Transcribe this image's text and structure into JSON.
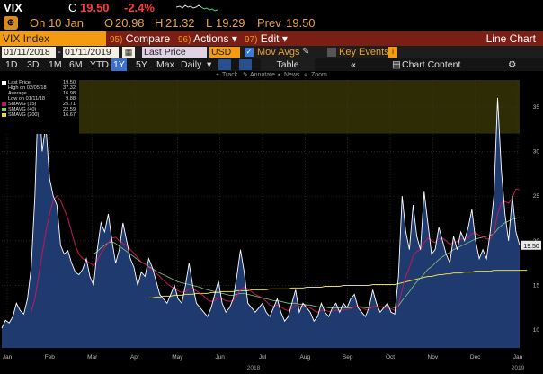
{
  "quote": {
    "ticker": "VIX",
    "c_label": "C",
    "last": "19.50",
    "change": "-2.4%",
    "date": "On 10 Jan",
    "open_label": "O",
    "open": "20.98",
    "high_label": "H",
    "high": "21.32",
    "low_label": "L",
    "low": "19.29",
    "prev_label": "Prev",
    "prev": "19.50"
  },
  "function_bar": {
    "index_label": "VIX Index",
    "compare_num": "95)",
    "compare": "Compare",
    "actions_num": "96)",
    "actions": "Actions",
    "edit_num": "97)",
    "edit": "Edit",
    "chart_type": "Line Chart"
  },
  "options": {
    "start_date": "01/11/2018",
    "end_date": "01/11/2019",
    "field": "Last Price",
    "currency": "USD",
    "mov_avgs": "Mov Avgs",
    "key_events": "Key Events"
  },
  "range": {
    "items": [
      "1D",
      "3D",
      "1M",
      "6M",
      "YTD",
      "1Y",
      "5Y",
      "Max"
    ],
    "selected": "1Y",
    "period": "Daily",
    "table": "Table",
    "chart_content": "Chart Content"
  },
  "subtools": {
    "track": "Track",
    "annotate": "Annotate",
    "news": "News",
    "zoom": "Zoom"
  },
  "legend": [
    {
      "name": "Last Price",
      "value": "19.50",
      "color": "#ffffff"
    },
    {
      "name": "High on 02/05/18",
      "value": "37.32",
      "color": "#000000"
    },
    {
      "name": "Average",
      "value": "16.98",
      "color": "#000000"
    },
    {
      "name": "Low on 01/11/18",
      "value": "9.88",
      "color": "#000000"
    },
    {
      "name": "SMAVG (15)",
      "value": "25.71",
      "color": "#c2185b"
    },
    {
      "name": "SMAVG (40)",
      "value": "22.59",
      "color": "#7fc97f"
    },
    {
      "name": "SMAVG (200)",
      "value": "16.67",
      "color": "#e6d84a"
    }
  ],
  "chart_data": {
    "type": "area",
    "ylim": [
      8,
      38
    ],
    "yticks": [
      10,
      15,
      20,
      25,
      30,
      35
    ],
    "x_labels": [
      "Jan",
      "Feb",
      "Mar",
      "Apr",
      "May",
      "Jun",
      "Jul",
      "Aug",
      "Sep",
      "Oct",
      "Nov",
      "Dec",
      "Jan"
    ],
    "year_labels": [
      "2018",
      "2019"
    ],
    "band": [
      32,
      38
    ],
    "series": [
      {
        "name": "Last Price",
        "values": [
          10.2,
          11.1,
          10.8,
          11.5,
          13.0,
          12.2,
          11.8,
          13.5,
          17.0,
          25.0,
          37.3,
          30.0,
          33.0,
          27.0,
          25.0,
          24.0,
          19.5,
          18.5,
          18.9,
          17.5,
          16.5,
          16.2,
          16.8,
          18.0,
          16.0,
          15.0,
          19.0,
          22.0,
          21.0,
          23.0,
          20.0,
          17.5,
          19.0,
          22.0,
          20.0,
          18.0,
          17.0,
          15.0,
          16.5,
          16.0,
          18.0,
          17.0,
          15.5,
          14.0,
          13.5,
          13.0,
          14.0,
          15.0,
          13.5,
          13.0,
          15.0,
          17.5,
          15.0,
          13.0,
          12.5,
          12.0,
          11.5,
          12.5,
          14.0,
          15.5,
          13.0,
          12.0,
          12.5,
          13.5,
          16.0,
          19.0,
          16.5,
          13.0,
          12.5,
          12.0,
          12.5,
          13.0,
          12.0,
          11.5,
          12.5,
          13.5,
          12.0,
          11.0,
          11.5,
          13.0,
          14.5,
          12.0,
          13.0,
          12.5,
          12.0,
          11.0,
          11.5,
          13.0,
          12.0,
          11.5,
          12.5,
          13.0,
          12.0,
          13.0,
          12.5,
          13.5,
          14.0,
          12.5,
          12.0,
          11.5,
          12.5,
          14.5,
          13.0,
          12.0,
          12.5,
          13.0,
          12.0,
          11.8,
          16.0,
          25.0,
          21.0,
          19.0,
          24.0,
          20.5,
          19.0,
          25.5,
          22.0,
          18.5,
          19.0,
          21.5,
          20.0,
          18.5,
          17.5,
          20.5,
          19.0,
          21.0,
          20.0,
          21.5,
          23.5,
          20.0,
          18.0,
          19.0,
          18.0,
          21.0,
          25.0,
          36.0,
          28.0,
          23.0,
          20.0,
          25.0,
          21.0,
          19.5
        ]
      },
      {
        "name": "SMAVG (15)",
        "values": [
          null,
          null,
          null,
          null,
          null,
          null,
          null,
          null,
          12.0,
          13.5,
          16.0,
          18.5,
          21.0,
          23.0,
          24.5,
          25.0,
          24.5,
          23.5,
          22.5,
          21.0,
          19.5,
          18.5,
          18.0,
          17.8,
          17.5,
          17.2,
          17.8,
          18.6,
          19.2,
          19.8,
          20.3,
          20.4,
          20.0,
          19.7,
          19.5,
          19.0,
          18.6,
          18.1,
          17.6,
          17.4,
          17.0,
          16.8,
          16.4,
          16.0,
          15.6,
          15.2,
          14.9,
          14.6,
          14.4,
          14.2,
          14.3,
          14.6,
          14.6,
          14.4,
          14.1,
          13.8,
          13.4,
          13.2,
          13.3,
          13.6,
          13.5,
          13.3,
          13.2,
          13.3,
          13.8,
          14.5,
          14.8,
          14.6,
          14.3,
          14.0,
          13.8,
          13.6,
          13.2,
          12.8,
          12.7,
          12.8,
          12.6,
          12.3,
          12.2,
          12.4,
          12.8,
          12.7,
          12.7,
          12.6,
          12.5,
          12.2,
          12.0,
          12.2,
          12.2,
          12.1,
          12.1,
          12.2,
          12.2,
          12.3,
          12.3,
          12.4,
          12.6,
          12.6,
          12.5,
          12.3,
          12.3,
          12.6,
          12.7,
          12.6,
          12.5,
          12.5,
          12.4,
          12.2,
          12.8,
          14.5,
          16.0,
          17.0,
          18.3,
          18.8,
          19.0,
          19.8,
          20.3,
          20.0,
          19.8,
          20.2,
          20.3,
          20.0,
          19.6,
          19.8,
          19.9,
          20.2,
          20.2,
          20.3,
          20.8,
          20.9,
          20.6,
          20.5,
          20.2,
          20.2,
          20.9,
          23.0,
          24.2,
          24.4,
          24.2,
          24.8,
          25.8,
          25.7
        ]
      },
      {
        "name": "SMAVG (40)",
        "values": [
          null,
          null,
          null,
          null,
          null,
          null,
          null,
          null,
          null,
          null,
          null,
          null,
          null,
          null,
          null,
          null,
          null,
          null,
          null,
          null,
          null,
          null,
          null,
          null,
          null,
          18.5,
          18.8,
          19.2,
          19.5,
          19.8,
          19.9,
          19.7,
          19.4,
          19.1,
          18.8,
          18.5,
          18.2,
          17.9,
          17.6,
          17.4,
          17.1,
          16.9,
          16.6,
          16.4,
          16.2,
          16.0,
          15.8,
          15.6,
          15.4,
          15.3,
          15.2,
          15.1,
          15.0,
          14.9,
          14.8,
          14.6,
          14.5,
          14.4,
          14.3,
          14.2,
          14.1,
          14.0,
          13.9,
          13.9,
          14.0,
          14.1,
          14.1,
          14.0,
          13.9,
          13.8,
          13.7,
          13.6,
          13.5,
          13.4,
          13.3,
          13.3,
          13.2,
          13.1,
          13.0,
          13.0,
          13.0,
          12.9,
          12.9,
          12.8,
          12.8,
          12.7,
          12.6,
          12.6,
          12.6,
          12.5,
          12.5,
          12.5,
          12.5,
          12.5,
          12.5,
          12.5,
          12.6,
          12.6,
          12.6,
          12.5,
          12.5,
          12.6,
          12.6,
          12.6,
          12.6,
          12.6,
          12.6,
          12.5,
          12.7,
          13.3,
          13.8,
          14.3,
          14.9,
          15.4,
          15.8,
          16.3,
          16.8,
          17.1,
          17.5,
          17.9,
          18.2,
          18.5,
          18.7,
          19.0,
          19.2,
          19.4,
          19.6,
          19.8,
          20.0,
          20.2,
          20.3,
          20.4,
          20.5,
          20.6,
          20.8,
          21.3,
          21.7,
          22.0,
          22.2,
          22.4,
          22.5,
          22.6
        ]
      },
      {
        "name": "SMAVG (200)",
        "values": [
          null,
          null,
          null,
          null,
          null,
          null,
          null,
          null,
          null,
          null,
          null,
          null,
          null,
          null,
          null,
          null,
          null,
          null,
          null,
          null,
          null,
          null,
          null,
          null,
          null,
          null,
          null,
          null,
          null,
          null,
          null,
          null,
          null,
          null,
          null,
          null,
          null,
          null,
          null,
          null,
          13.6,
          13.6,
          13.7,
          13.7,
          13.8,
          13.8,
          13.8,
          13.9,
          13.9,
          13.9,
          14.0,
          14.0,
          14.0,
          14.1,
          14.1,
          14.1,
          14.1,
          14.2,
          14.2,
          14.2,
          14.3,
          14.3,
          14.3,
          14.3,
          14.4,
          14.4,
          14.4,
          14.4,
          14.5,
          14.5,
          14.5,
          14.5,
          14.5,
          14.6,
          14.6,
          14.6,
          14.6,
          14.6,
          14.6,
          14.7,
          14.7,
          14.7,
          14.7,
          14.8,
          14.8,
          14.8,
          14.8,
          14.8,
          14.9,
          14.9,
          14.9,
          14.9,
          14.9,
          15.0,
          15.0,
          15.0,
          15.0,
          15.0,
          15.0,
          15.0,
          15.0,
          15.1,
          15.1,
          15.1,
          15.1,
          15.1,
          15.1,
          15.1,
          15.2,
          15.3,
          15.4,
          15.5,
          15.6,
          15.7,
          15.8,
          15.9,
          16.0,
          16.0,
          16.1,
          16.2,
          16.2,
          16.3,
          16.3,
          16.4,
          16.4,
          16.4,
          16.5,
          16.5,
          16.5,
          16.6,
          16.6,
          16.6,
          16.6,
          16.6,
          16.7,
          16.7,
          16.7,
          16.7,
          16.7,
          16.7,
          16.7,
          16.7,
          16.7,
          16.7
        ]
      }
    ]
  },
  "colors": {
    "accent": "#f39c12",
    "negative": "#ff3b3b",
    "function_bar": "#7a1e16",
    "area_fill": "#1f3a6e",
    "band": "#2e2c04"
  }
}
